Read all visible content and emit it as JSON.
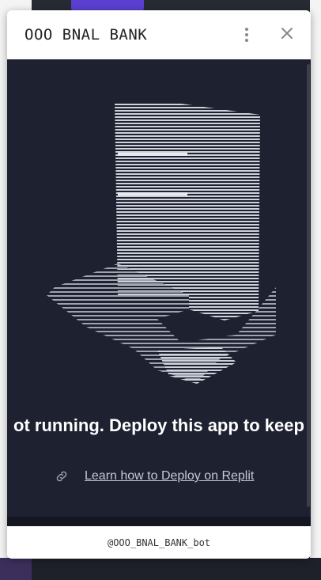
{
  "modal": {
    "title": "OOO BNAL BANK",
    "notice": "ot running. Deploy this app to keep",
    "learn_link": "Learn how to Deploy on Replit",
    "footer_handle": "@OOO_BNAL_BANK_bot"
  },
  "icons": {
    "more": "more-vertical-icon",
    "close": "close-icon",
    "link": "link-icon"
  },
  "colors": {
    "body_bg": "#1d2130",
    "modal_bg": "#ffffff",
    "accent": "#5b3fd0",
    "link_text": "#c5c9d6"
  }
}
